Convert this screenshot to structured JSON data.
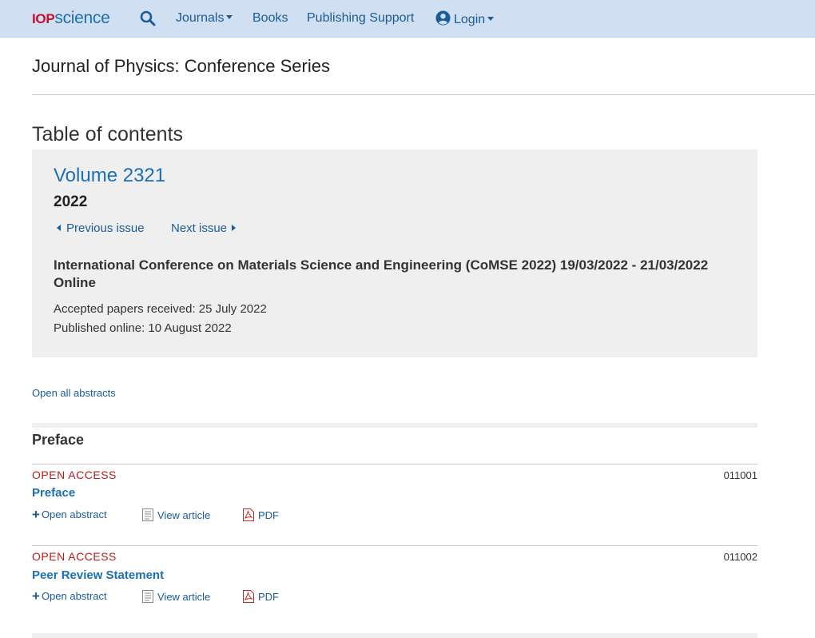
{
  "nav": {
    "logo_iop": "IOP",
    "logo_science": "science",
    "items": [
      {
        "label": "Journals"
      },
      {
        "label": "Books"
      },
      {
        "label": "Publishing Support"
      },
      {
        "label": "Login"
      }
    ],
    "icons": {
      "search": "search-icon",
      "user": "user-circle-icon"
    }
  },
  "journal_title": "Journal of Physics: Conference Series",
  "toc_heading": "Table of contents",
  "volume": {
    "title": "Volume 2321",
    "year": "2022",
    "prev_label": "Previous issue",
    "next_label": "Next issue",
    "conference": "International Conference on Materials Science and Engineering (CoMSE 2022) 19/03/2022 - 21/03/2022 Online",
    "accepted": "Accepted papers received: 25 July 2022",
    "published": "Published online: 10 August 2022"
  },
  "open_all_abstracts": "Open all abstracts",
  "section": {
    "title": "Preface"
  },
  "articles": [
    {
      "access": "OPEN ACCESS",
      "number": "011001",
      "title": "Preface",
      "open_abstract": "Open abstract",
      "view_article": "View article",
      "pdf": "PDF"
    },
    {
      "access": "OPEN ACCESS",
      "number": "011002",
      "title": "Peer Review Statement",
      "open_abstract": "Open abstract",
      "view_article": "View article",
      "pdf": "PDF"
    }
  ],
  "colors": {
    "nav_bg": "#d0dff2",
    "link": "#1d6fb3",
    "open_access": "#b71c1c",
    "box_bg": "#efefef"
  }
}
